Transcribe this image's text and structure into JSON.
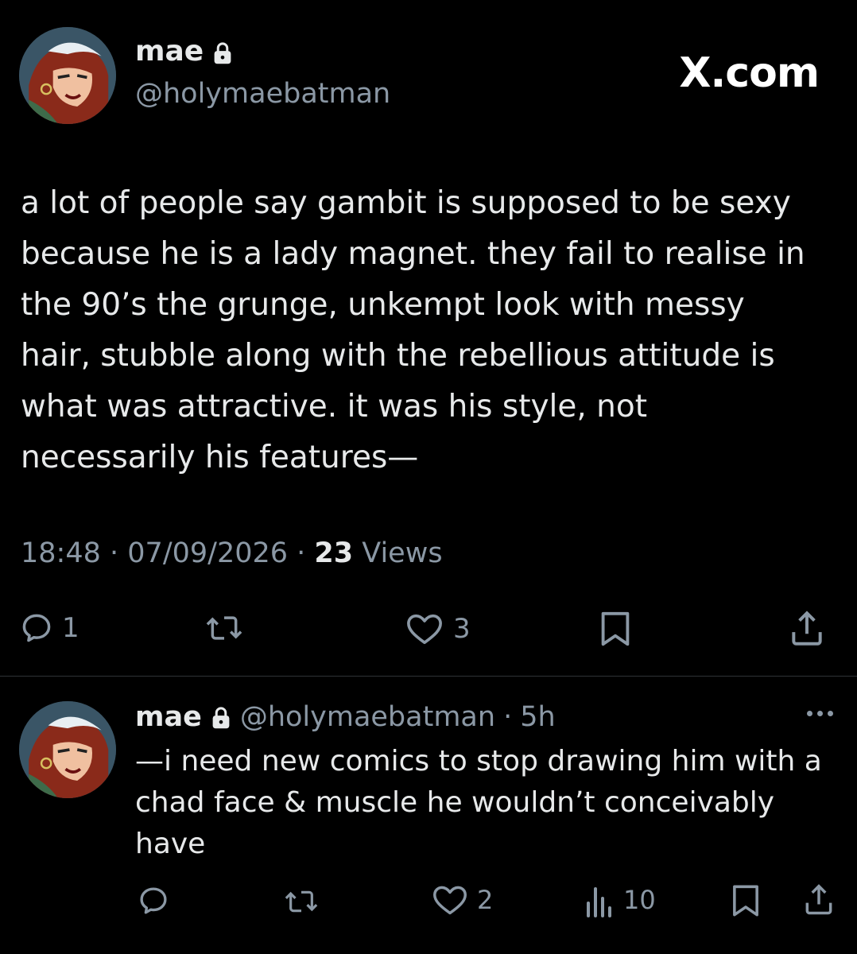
{
  "brand": "X.com",
  "main_tweet": {
    "name": "mae",
    "handle": "@holymaebatman",
    "text": "a lot of people say gambit is supposed to be sexy\nbecause he is a lady magnet. they fail to realise in\nthe 90’s the grunge, unkempt look with messy\nhair, stubble along with the rebellious attitude is\nwhat was attractive. it was his style, not\nnecessarily his features—",
    "time": "18:48",
    "date": "07/09/2026",
    "views_count": "23",
    "views_label": "Views",
    "reply_count": "1",
    "like_count": "3"
  },
  "reply": {
    "name": "mae",
    "handle": "@holymaebatman",
    "age": "5h",
    "text": "—i need new comics to stop drawing him with a\nchad face & muscle he wouldn’t conceivably\nhave",
    "like_count": "2",
    "view_count": "10"
  },
  "icons": {
    "lock": "lock-icon",
    "reply": "reply-icon",
    "retweet": "retweet-icon",
    "like": "heart-icon",
    "bookmark": "bookmark-icon",
    "share": "share-icon",
    "views": "analytics-icon",
    "more": "more-icon"
  },
  "colors": {
    "background": "#000000",
    "text": "#e7e9ea",
    "muted": "#8b98a5",
    "divider": "#2f3336"
  }
}
